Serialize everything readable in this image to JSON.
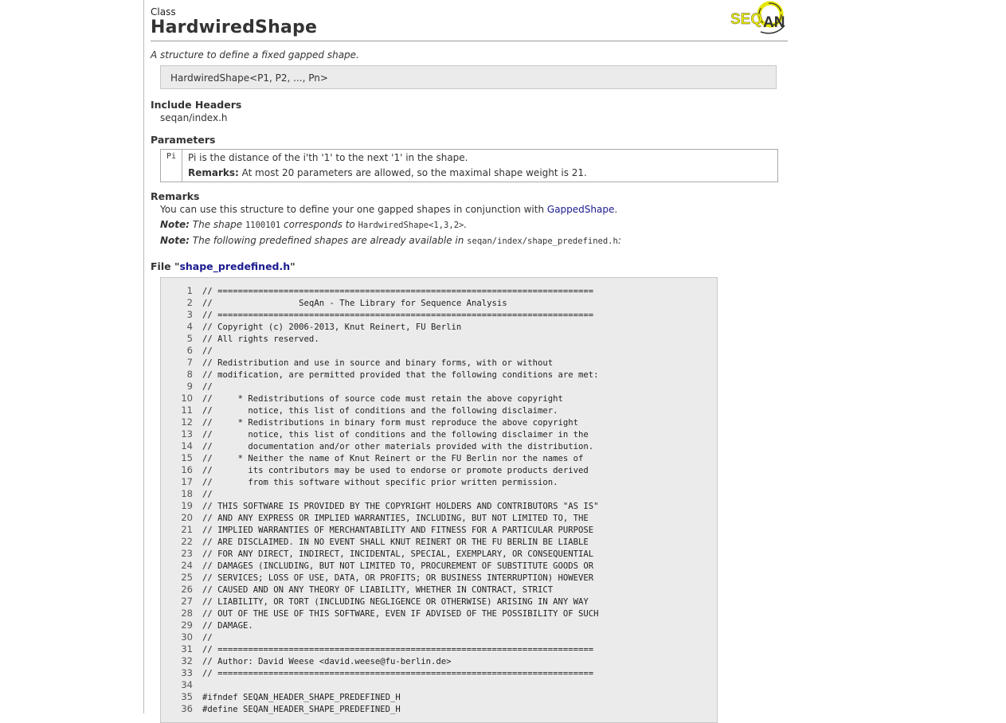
{
  "page": {
    "class_label": "Class",
    "class_name": "HardwiredShape",
    "logo_text": "SEQAN",
    "brief": "A structure to define a fixed gapped shape.",
    "signature": "HardwiredShape<P1, P2, ..., Pn>"
  },
  "include": {
    "heading": "Include Headers",
    "header": "seqan/index.h"
  },
  "parameters": {
    "heading": "Parameters",
    "name": "Pi",
    "description": "Pi is the distance of the i'th '1' to the next '1' in the shape.",
    "remark_label": "Remarks:",
    "remark_text": "At most 20 parameters are allowed, so the maximal shape weight is 21."
  },
  "remarks": {
    "heading": "Remarks",
    "line1_prefix": "You can use this structure to define your one gapped shapes in conjunction with ",
    "line1_link": "GappedShape",
    "line1_suffix": ".",
    "note1_label": "Note:",
    "note1_a": " The shape ",
    "note1_code1": "1100101",
    "note1_b": " corresponds to ",
    "note1_code2": "HardwiredShape<1,3,2>",
    "note1_c": ".",
    "note2_label": "Note:",
    "note2_a": " The following predefined shapes are already available in ",
    "note2_code": "seqan/index/shape_predefined.h",
    "note2_b": ":"
  },
  "file": {
    "prefix": "File \"",
    "name": "shape_predefined.h",
    "suffix": "\""
  },
  "code_lines": [
    {
      "num": "1",
      "text": "// =========================================================================="
    },
    {
      "num": "2",
      "text": "//                 SeqAn - The Library for Sequence Analysis"
    },
    {
      "num": "3",
      "text": "// =========================================================================="
    },
    {
      "num": "4",
      "text": "// Copyright (c) 2006-2013, Knut Reinert, FU Berlin"
    },
    {
      "num": "5",
      "text": "// All rights reserved."
    },
    {
      "num": "6",
      "text": "//"
    },
    {
      "num": "7",
      "text": "// Redistribution and use in source and binary forms, with or without"
    },
    {
      "num": "8",
      "text": "// modification, are permitted provided that the following conditions are met:"
    },
    {
      "num": "9",
      "text": "//"
    },
    {
      "num": "10",
      "text": "//     * Redistributions of source code must retain the above copyright"
    },
    {
      "num": "11",
      "text": "//       notice, this list of conditions and the following disclaimer."
    },
    {
      "num": "12",
      "text": "//     * Redistributions in binary form must reproduce the above copyright"
    },
    {
      "num": "13",
      "text": "//       notice, this list of conditions and the following disclaimer in the"
    },
    {
      "num": "14",
      "text": "//       documentation and/or other materials provided with the distribution."
    },
    {
      "num": "15",
      "text": "//     * Neither the name of Knut Reinert or the FU Berlin nor the names of"
    },
    {
      "num": "16",
      "text": "//       its contributors may be used to endorse or promote products derived"
    },
    {
      "num": "17",
      "text": "//       from this software without specific prior written permission."
    },
    {
      "num": "18",
      "text": "//"
    },
    {
      "num": "19",
      "text": "// THIS SOFTWARE IS PROVIDED BY THE COPYRIGHT HOLDERS AND CONTRIBUTORS \"AS IS\""
    },
    {
      "num": "20",
      "text": "// AND ANY EXPRESS OR IMPLIED WARRANTIES, INCLUDING, BUT NOT LIMITED TO, THE"
    },
    {
      "num": "21",
      "text": "// IMPLIED WARRANTIES OF MERCHANTABILITY AND FITNESS FOR A PARTICULAR PURPOSE"
    },
    {
      "num": "22",
      "text": "// ARE DISCLAIMED. IN NO EVENT SHALL KNUT REINERT OR THE FU BERLIN BE LIABLE"
    },
    {
      "num": "23",
      "text": "// FOR ANY DIRECT, INDIRECT, INCIDENTAL, SPECIAL, EXEMPLARY, OR CONSEQUENTIAL"
    },
    {
      "num": "24",
      "text": "// DAMAGES (INCLUDING, BUT NOT LIMITED TO, PROCUREMENT OF SUBSTITUTE GOODS OR"
    },
    {
      "num": "25",
      "text": "// SERVICES; LOSS OF USE, DATA, OR PROFITS; OR BUSINESS INTERRUPTION) HOWEVER"
    },
    {
      "num": "26",
      "text": "// CAUSED AND ON ANY THEORY OF LIABILITY, WHETHER IN CONTRACT, STRICT"
    },
    {
      "num": "27",
      "text": "// LIABILITY, OR TORT (INCLUDING NEGLIGENCE OR OTHERWISE) ARISING IN ANY WAY"
    },
    {
      "num": "28",
      "text": "// OUT OF THE USE OF THIS SOFTWARE, EVEN IF ADVISED OF THE POSSIBILITY OF SUCH"
    },
    {
      "num": "29",
      "text": "// DAMAGE."
    },
    {
      "num": "30",
      "text": "//"
    },
    {
      "num": "31",
      "text": "// =========================================================================="
    },
    {
      "num": "32",
      "text": "// Author: David Weese <david.weese@fu-berlin.de>"
    },
    {
      "num": "33",
      "text": "// =========================================================================="
    },
    {
      "num": "34",
      "text": ""
    },
    {
      "num": "35",
      "text": "#ifndef SEQAN_HEADER_SHAPE_PREDEFINED_H"
    },
    {
      "num": "36",
      "text": "#define SEQAN_HEADER_SHAPE_PREDEFINED_H"
    }
  ],
  "colors": {
    "link": "#1a1a8f",
    "code_background": "#ebebeb",
    "logo_yellow": "#e6e600",
    "logo_dark": "#333333"
  }
}
